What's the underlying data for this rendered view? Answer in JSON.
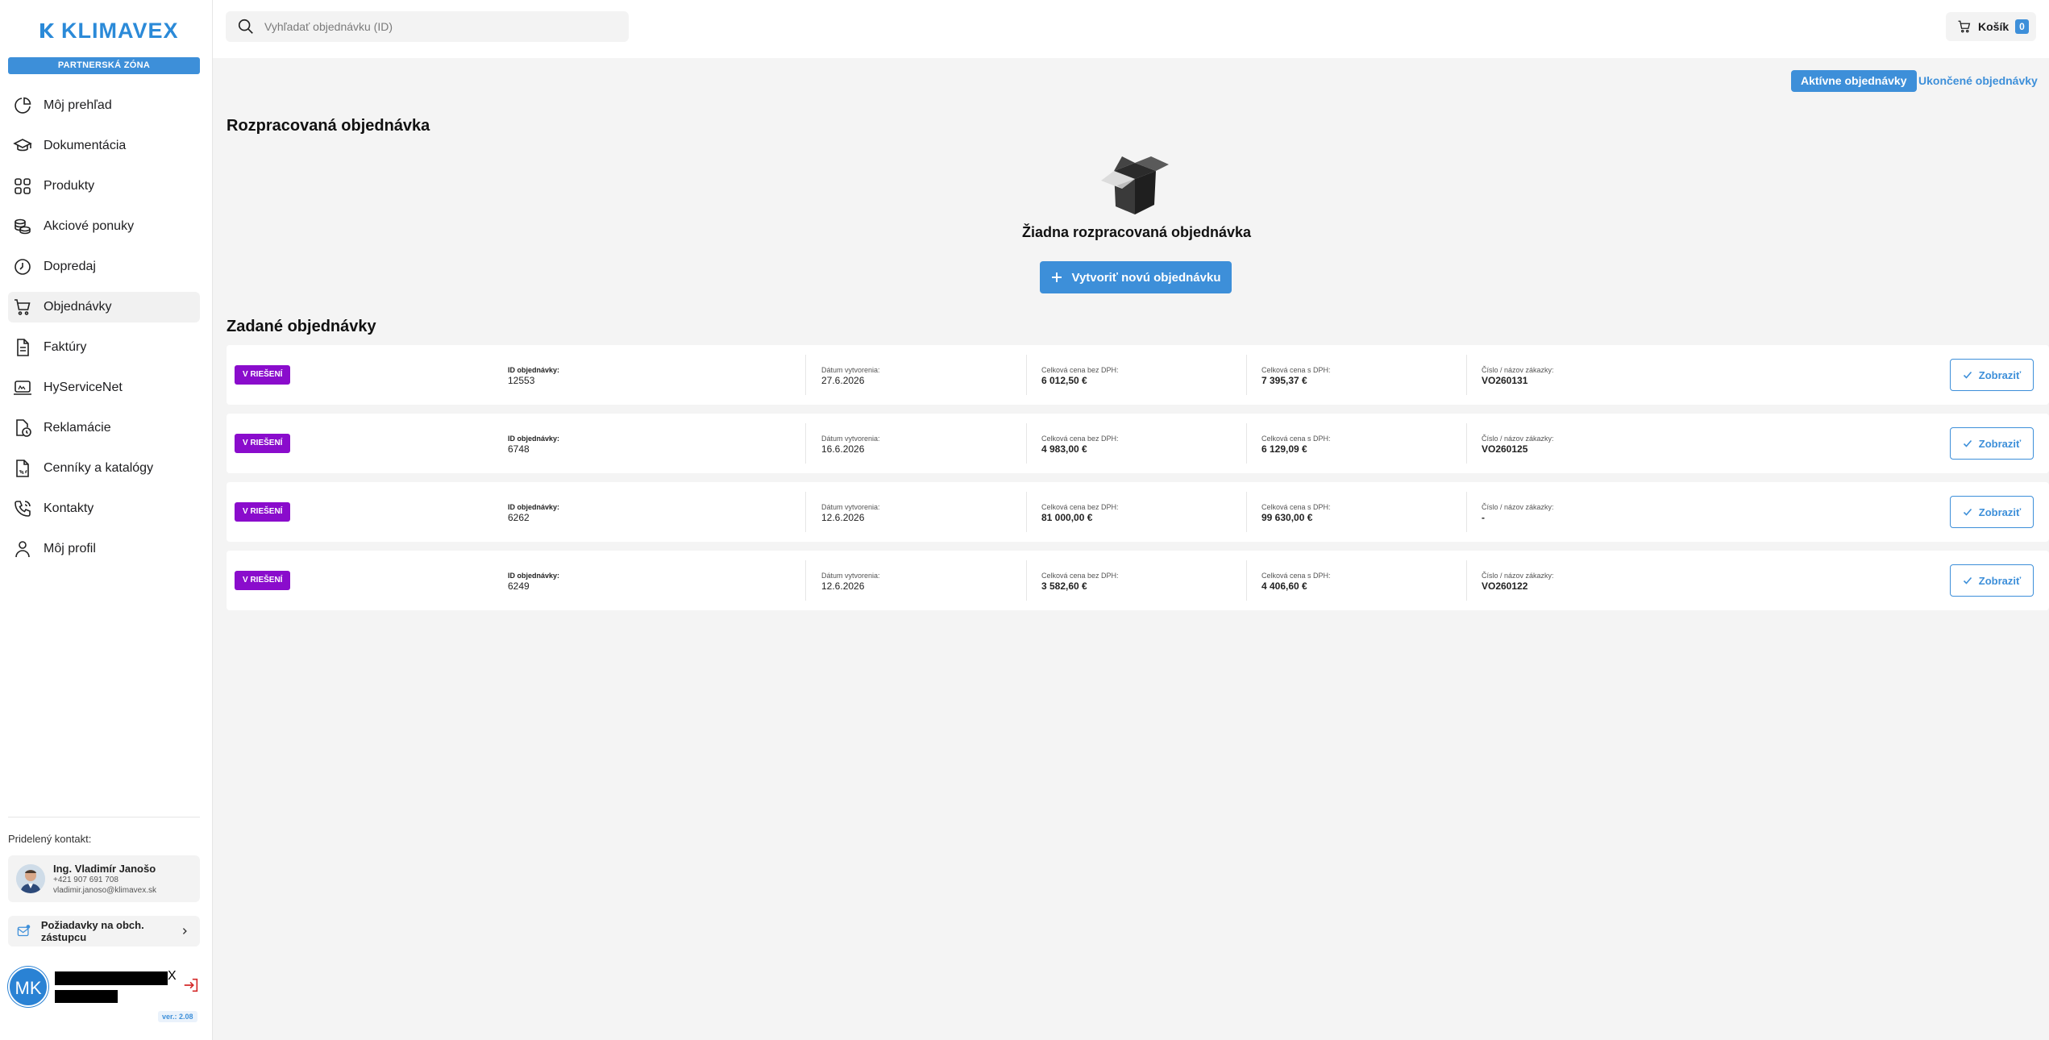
{
  "brand": {
    "name": "KLIMAVEX",
    "zone": "PARTNERSKÁ ZÓNA",
    "accent": "#3d8fd9",
    "status_color": "#8a0ccc"
  },
  "sidebar": {
    "items": [
      {
        "label": "Môj prehľad",
        "icon": "pie-chart-icon"
      },
      {
        "label": "Dokumentácia",
        "icon": "graduation-cap-icon"
      },
      {
        "label": "Produkty",
        "icon": "grid-icon"
      },
      {
        "label": "Akciové ponuky",
        "icon": "coins-icon"
      },
      {
        "label": "Dopredaj",
        "icon": "clock-icon"
      },
      {
        "label": "Objednávky",
        "icon": "cart-icon",
        "active": true
      },
      {
        "label": "Faktúry",
        "icon": "document-icon"
      },
      {
        "label": "HyServiceNet",
        "icon": "laptop-icon"
      },
      {
        "label": "Reklamácie",
        "icon": "file-clock-icon"
      },
      {
        "label": "Cenníky a katalógy",
        "icon": "pdf-file-icon"
      },
      {
        "label": "Kontakty",
        "icon": "phone-icon"
      },
      {
        "label": "Môj profil",
        "icon": "user-icon"
      }
    ],
    "contact_label": "Pridelený kontakt:",
    "contact": {
      "name": "Ing. Vladimír Janošo",
      "phone": "+421 907 691 708",
      "email": "vladimir.janoso@klimavex.sk"
    },
    "requests_label": "Požiadavky na obch. zástupcu",
    "user": {
      "initials": "MK",
      "redacted_suffix": "X"
    },
    "version": "ver.: 2.08"
  },
  "header": {
    "search_placeholder": "Vyhľadať objednávku (ID)",
    "cart_label": "Košík",
    "cart_count": "0"
  },
  "main": {
    "tabs": {
      "active": "Aktívne objednávky",
      "inactive": "Ukončené objednávky"
    },
    "draft_title": "Rozpracovaná objednávka",
    "empty_text": "Žiadna rozpracovaná objednávka",
    "create_label": "Vytvoriť novú objednávku",
    "orders_title": "Zadané objednávky",
    "labels": {
      "id": "ID objednávky:",
      "date": "Dátum vytvorenia:",
      "net": "Celková cena bez DPH:",
      "gross": "Celková cena s DPH:",
      "ref": "Číslo / názov zákazky:",
      "view": "Zobraziť"
    },
    "orders": [
      {
        "status": "V RIEŠENÍ",
        "id": "12553",
        "date": "27.6.2026",
        "net": "6 012,50 €",
        "gross": "7 395,37 €",
        "ref": "VO260131"
      },
      {
        "status": "V RIEŠENÍ",
        "id": "6748",
        "date": "16.6.2026",
        "net": "4 983,00 €",
        "gross": "6 129,09 €",
        "ref": "VO260125"
      },
      {
        "status": "V RIEŠENÍ",
        "id": "6262",
        "date": "12.6.2026",
        "net": "81 000,00 €",
        "gross": "99 630,00 €",
        "ref": "-"
      },
      {
        "status": "V RIEŠENÍ",
        "id": "6249",
        "date": "12.6.2026",
        "net": "3 582,60 €",
        "gross": "4 406,60 €",
        "ref": "VO260122"
      }
    ]
  }
}
